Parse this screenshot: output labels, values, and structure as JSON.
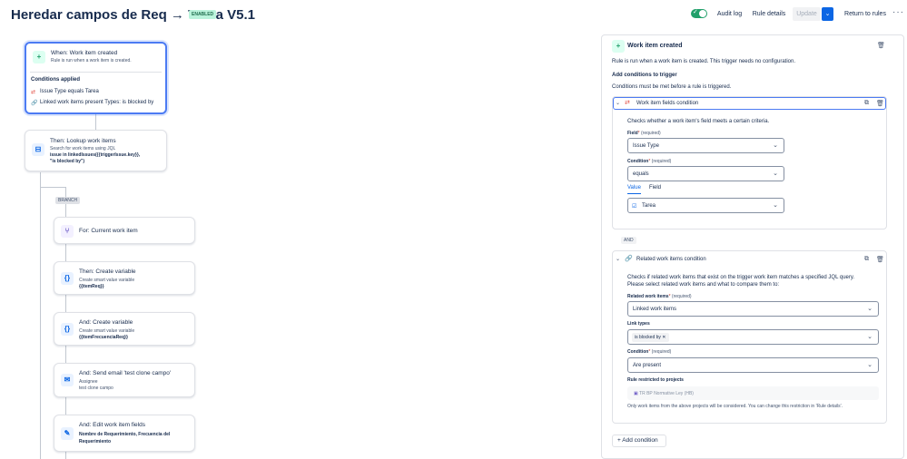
{
  "header": {
    "title": "Heredar campos de Req → Tarea V5.1",
    "status_badge": "ENABLED",
    "audit_log": "Audit log",
    "rule_details": "Rule details",
    "update": "Update",
    "return_to_rules": "Return to rules",
    "more": "···"
  },
  "canvas": {
    "trigger": {
      "title": "When: Work item created",
      "subtitle": "Rule is run when a work item is created.",
      "conditions_title": "Conditions applied",
      "conditions": [
        {
          "icon": "swap-icon",
          "text": "Issue Type equals Tarea"
        },
        {
          "icon": "link-icon",
          "text": "Linked work items present Types: is blocked by"
        }
      ]
    },
    "lookup": {
      "title": "Then: Lookup work items",
      "subtitle": "Search for work items using JQL",
      "jql1": "issue in linkedIssues({{triggerIssue.key}},",
      "jql2": "\"is blocked by\")"
    },
    "branch_label": "BRANCH",
    "for_item": {
      "title": "For: Current work item"
    },
    "create_var1": {
      "title": "Then: Create variable",
      "subtitle": "Create smart value variable",
      "value": "{{itemReq}}"
    },
    "create_var2": {
      "title": "And: Create variable",
      "subtitle": "Create smart value variable",
      "value": "{{itemFrecuenciaReq}}"
    },
    "send_email": {
      "title": "And: Send email 'test clone campo'",
      "line1": "Assignee",
      "line2": "test clone campo"
    },
    "edit_fields": {
      "title": "And: Edit work item fields",
      "value1": "Nombre de Requerimiento, Frecuencia del",
      "value2": "Requerimiento"
    }
  },
  "panel": {
    "title": "Work item created",
    "description": "Rule is run when a work item is created. This trigger needs no configuration.",
    "add_conditions_title": "Add conditions to trigger",
    "add_conditions_sub": "Conditions must be met before a rule is triggered.",
    "cond1": {
      "title": "Work item fields condition",
      "desc": "Checks whether a work item's field meets a certain criteria.",
      "field_label": "Field",
      "field_req": "(required)",
      "field_value": "Issue Type",
      "condition_label": "Condition",
      "condition_req": "(required)",
      "condition_value": "equals",
      "tab_value": "Value",
      "tab_field": "Field",
      "value_value": "Tarea"
    },
    "and_label": "AND",
    "cond2": {
      "title": "Related work items condition",
      "desc1": "Checks if related work items that exist on the trigger work item matches a specified JQL query.",
      "desc2": "Please select related work items and what to compare them to:",
      "related_label": "Related work items",
      "related_req": "(required)",
      "related_value": "Linked work items",
      "link_types_label": "Link types",
      "link_tag": "is blocked by",
      "condition_label": "Condition",
      "condition_req": "(required)",
      "condition_value": "Are present",
      "restricted_label": "Rule restricted to projects",
      "project": "TR BP Normative Ley (HB)",
      "footer": "Only work items from the above projects will be considered. You can change this restriction in 'Rule details'."
    },
    "add_condition": "Add condition",
    "required_mark": "*"
  }
}
